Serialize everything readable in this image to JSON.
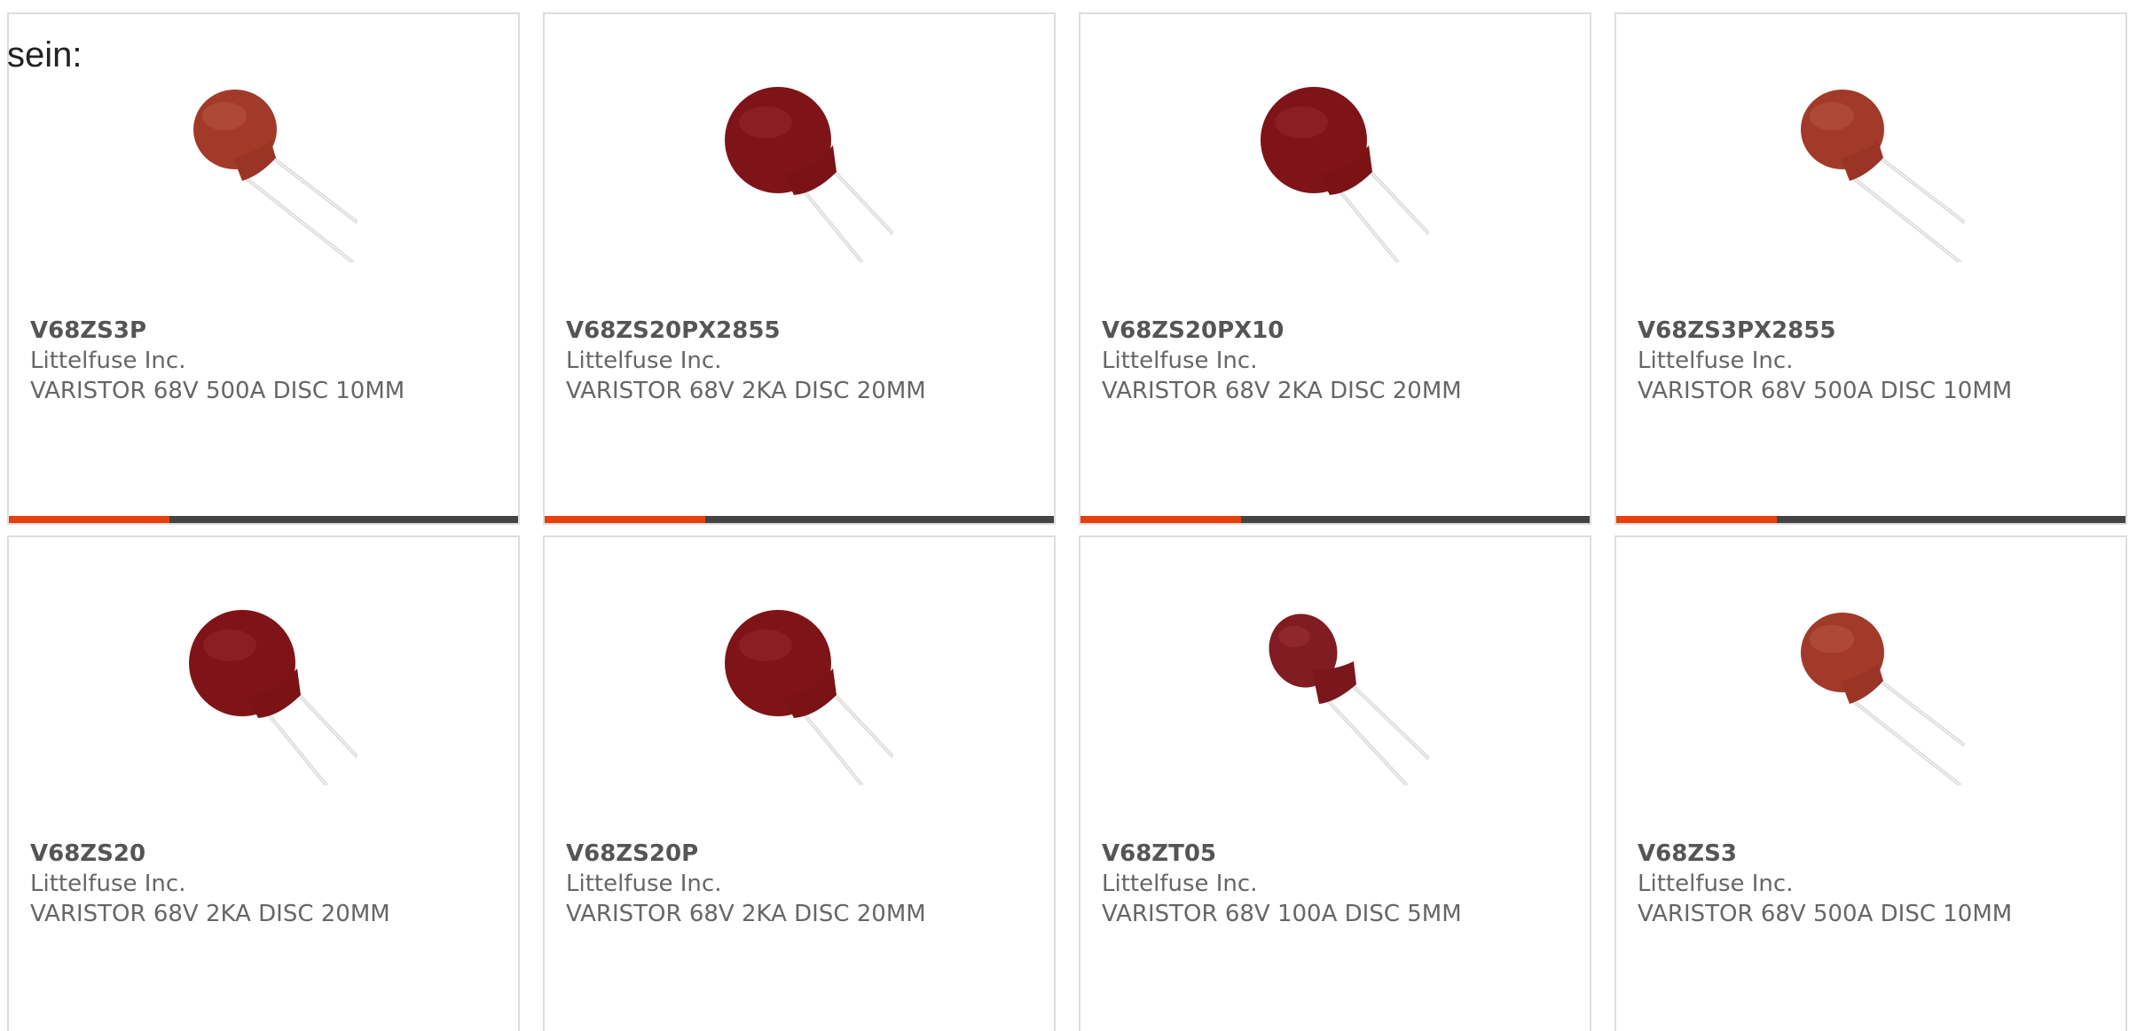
{
  "intro_text": "sein:",
  "colors": {
    "accent": "#e8400c",
    "bar_track": "#444444",
    "card_border": "#dddddd",
    "text": "#666666"
  },
  "products": [
    {
      "part": "V68ZS3P",
      "manufacturer": "Littelfuse Inc.",
      "description": "VARISTOR 68V 500A DISC 10MM",
      "image_icon": "varistor-disc-brown-icon",
      "progress_fraction": 0.315
    },
    {
      "part": "V68ZS20PX2855",
      "manufacturer": "Littelfuse Inc.",
      "description": "VARISTOR 68V 2KA DISC 20MM",
      "image_icon": "varistor-disc-large-icon",
      "progress_fraction": 0.315
    },
    {
      "part": "V68ZS20PX10",
      "manufacturer": "Littelfuse Inc.",
      "description": "VARISTOR 68V 2KA DISC 20MM",
      "image_icon": "varistor-disc-large-icon",
      "progress_fraction": 0.315
    },
    {
      "part": "V68ZS3PX2855",
      "manufacturer": "Littelfuse Inc.",
      "description": "VARISTOR 68V 500A DISC 10MM",
      "image_icon": "varistor-disc-brown-icon",
      "progress_fraction": 0.315
    },
    {
      "part": "V68ZS20",
      "manufacturer": "Littelfuse Inc.",
      "description": "VARISTOR 68V 2KA DISC 20MM",
      "image_icon": "varistor-disc-large-icon"
    },
    {
      "part": "V68ZS20P",
      "manufacturer": "Littelfuse Inc.",
      "description": "VARISTOR 68V 2KA DISC 20MM",
      "image_icon": "varistor-disc-large-icon"
    },
    {
      "part": "V68ZT05",
      "manufacturer": "Littelfuse Inc.",
      "description": "VARISTOR 68V 100A DISC 5MM",
      "image_icon": "varistor-disc-small-icon"
    },
    {
      "part": "V68ZS3",
      "manufacturer": "Littelfuse Inc.",
      "description": "VARISTOR 68V 500A DISC 10MM",
      "image_icon": "varistor-disc-brown-icon"
    }
  ]
}
